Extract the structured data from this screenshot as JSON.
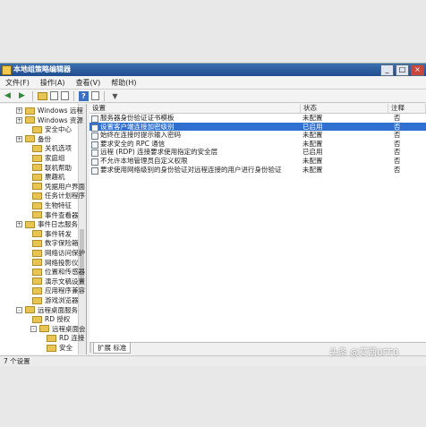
{
  "window": {
    "title": "本地组策略编辑器",
    "buttons": {
      "minimize": "_",
      "maximize": "□",
      "close": "×"
    }
  },
  "menubar": [
    "文件(F)",
    "操作(A)",
    "查看(V)",
    "帮助(H)"
  ],
  "tree": [
    {
      "label": "Windows 远程",
      "expander": "+"
    },
    {
      "label": "Windows 资源",
      "expander": "+"
    },
    {
      "label": "安全中心",
      "expander": ""
    },
    {
      "label": "备份",
      "expander": "+"
    },
    {
      "label": "关机选项",
      "expander": ""
    },
    {
      "label": "家庭组",
      "expander": ""
    },
    {
      "label": "联机帮助",
      "expander": ""
    },
    {
      "label": "票趣机",
      "expander": ""
    },
    {
      "label": "凭据用户界面",
      "expander": ""
    },
    {
      "label": "任务计划程序",
      "expander": ""
    },
    {
      "label": "生物特征",
      "expander": ""
    },
    {
      "label": "事件查看器",
      "expander": ""
    },
    {
      "label": "事件日志服务",
      "expander": "+"
    },
    {
      "label": "事件转发",
      "expander": ""
    },
    {
      "label": "数字保险箱",
      "expander": ""
    },
    {
      "label": "网络访问保护",
      "expander": ""
    },
    {
      "label": "网络投影仪",
      "expander": ""
    },
    {
      "label": "位置和传感器",
      "expander": ""
    },
    {
      "label": "演示文稿设置",
      "expander": ""
    },
    {
      "label": "应用程序兼容",
      "expander": ""
    },
    {
      "label": "游戏浏览器",
      "expander": ""
    },
    {
      "label": "远程桌面服务",
      "expander": "-"
    },
    {
      "label": "RD 授权",
      "expander": ""
    },
    {
      "label": "远程桌面会",
      "expander": "-"
    },
    {
      "label": "RD 连接",
      "expander": ""
    },
    {
      "label": "安全",
      "expander": ""
    }
  ],
  "list": {
    "columns": {
      "setting": "设置",
      "state": "状态",
      "comment": "注释"
    },
    "rows": [
      {
        "setting": "服务器身份验证证书模板",
        "state": "未配置",
        "comment": "否"
      },
      {
        "setting": "设置客户端连接加密级别",
        "state": "已启用",
        "comment": "否"
      },
      {
        "setting": "始终在连接时提示输入密码",
        "state": "未配置",
        "comment": "否"
      },
      {
        "setting": "要求安全的 RPC 通信",
        "state": "未配置",
        "comment": "否"
      },
      {
        "setting": "远程 (RDP) 连接要求使用指定的安全层",
        "state": "已启用",
        "comment": "否"
      },
      {
        "setting": "不允许本地管理员自定义权限",
        "state": "未配置",
        "comment": "否"
      },
      {
        "setting": "要求使用网络级别的身份验证对远程连接的用户进行身份验证",
        "state": "未配置",
        "comment": "否"
      }
    ],
    "selected_index": 1
  },
  "tabs": [
    "扩展",
    "标准"
  ],
  "status": "7 个设置",
  "watermark": "头条 @艾西0FF0"
}
